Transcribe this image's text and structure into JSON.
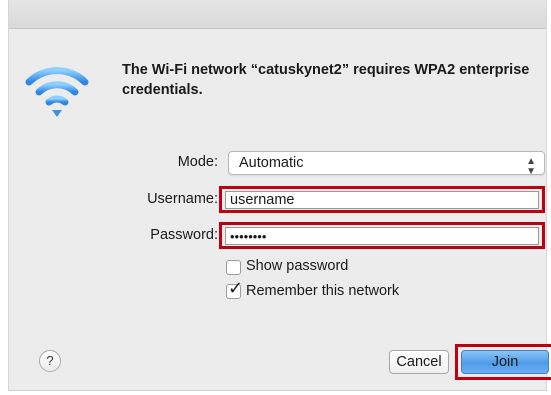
{
  "dialog": {
    "message": "The Wi-Fi network “catuskynet2” requires WPA2 enterprise credentials."
  },
  "form": {
    "mode_label": "Mode:",
    "mode_value": "Automatic",
    "username_label": "Username:",
    "username_value": "username",
    "password_label": "Password:",
    "password_value": "••••••••"
  },
  "options": {
    "show_password_label": "Show password",
    "show_password_checked": false,
    "remember_label": "Remember this network",
    "remember_checked": true
  },
  "buttons": {
    "help": "?",
    "cancel": "Cancel",
    "join": "Join"
  },
  "colors": {
    "highlight": "#c00010",
    "join_button": "#4f9be9",
    "wifi_icon": "#3d9be9"
  },
  "icons": {
    "dialog_icon": "wifi-icon",
    "mode_chevron": "up-down-chevron-icon",
    "remember_check": "checkmark-icon"
  }
}
